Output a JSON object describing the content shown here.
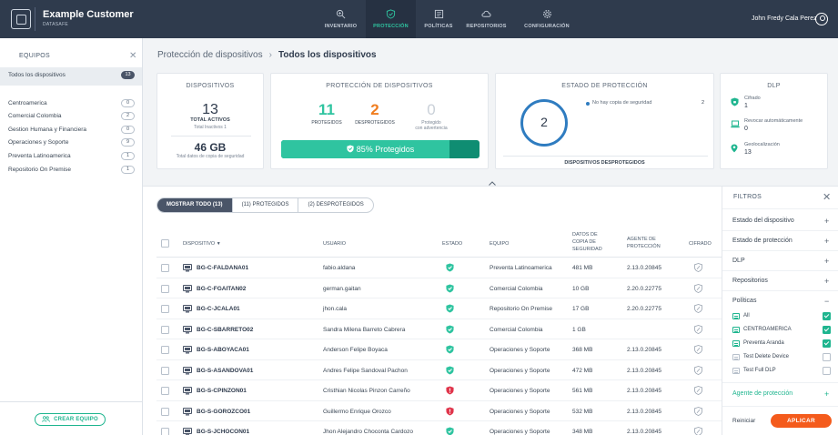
{
  "header": {
    "brand_title": "Example Customer",
    "brand_subtitle": "DATASAFE",
    "nav": [
      {
        "label": "INVENTARIO",
        "icon": "search-icon"
      },
      {
        "label": "PROTECCIÓN",
        "icon": "shield-icon",
        "active": true
      },
      {
        "label": "POLÍTICAS",
        "icon": "document-icon"
      },
      {
        "label": "REPOSITORIOS",
        "icon": "cloud-icon"
      },
      {
        "label": "CONFIGURACIÓN",
        "icon": "gear-icon"
      }
    ],
    "user_name": "John Fredy Cala Perez"
  },
  "sidebar": {
    "title": "EQUIPOS",
    "items": [
      {
        "label": "Todos los dispositivos",
        "count": "13"
      },
      {
        "label": "Centroamerica",
        "count": "0"
      },
      {
        "label": "Comercial Colombia",
        "count": "2"
      },
      {
        "label": "Gestion Humana y Financiera",
        "count": "0"
      },
      {
        "label": "Operaciones y Soporte",
        "count": "9"
      },
      {
        "label": "Preventa Latinoamerica",
        "count": "1"
      },
      {
        "label": "Repositorio On Premise",
        "count": "1"
      }
    ],
    "create_button": "CREAR EQUIPO"
  },
  "breadcrumb": {
    "parent": "Protección de dispositivos",
    "current": "Todos los dispositivos"
  },
  "cards": {
    "devices": {
      "title": "DISPOSITIVOS",
      "total": "13",
      "total_label": "TOTAL ACTIVOS",
      "inactive_label": "Total Inactivos 1",
      "backup_size": "46 GB",
      "backup_label": "Total datos de copia de seguridad"
    },
    "protection": {
      "title": "PROTECCIÓN DE DISPOSITIVOS",
      "protected": "11",
      "protected_label": "PROTEGIDOS",
      "unprotected": "2",
      "unprotected_label": "DESPROTEGIDOS",
      "warning": "0",
      "warning_label_1": "Protegido",
      "warning_label_2": "con advertencia",
      "progress_percent": 85,
      "progress_label": "85% Protegidos"
    },
    "status": {
      "title": "ESTADO DE PROTECCIÓN",
      "donut_value": "2",
      "legend_label": "No hay copia de seguridad",
      "legend_value": "2",
      "footer": "DISPOSITIVOS DESPROTEGIDOS"
    },
    "dlp": {
      "title": "DLP",
      "items": [
        {
          "label": "Cifrado",
          "value": "1"
        },
        {
          "label": "Revocar automáticamente",
          "value": "0"
        },
        {
          "label": "Geolocalización",
          "value": "13"
        }
      ]
    }
  },
  "tabs": [
    "MOSTRAR TODO (13)",
    "(11) PROTEGIDOS",
    "(2) DESPROTEGIDOS"
  ],
  "table": {
    "headers": {
      "device": "DISPOSITIVO",
      "user": "USUARIO",
      "status": "ESTADO",
      "team": "EQUIPO",
      "backup_1": "DATOS DE",
      "backup_2": "COPIA DE",
      "backup_3": "SEGURIDAD",
      "agent_1": "AGENTE DE",
      "agent_2": "PROTECCIÓN",
      "encrypt": "CIFRADO"
    },
    "rows": [
      {
        "device": "BG-C-FALDANA01",
        "user": "fabio.aldana",
        "status": "protected",
        "team": "Preventa Latinoamerica",
        "backup": "481 MB",
        "agent": "2.13.0.20845"
      },
      {
        "device": "BG-C-FGAITAN02",
        "user": "german.gaitan",
        "status": "protected",
        "team": "Comercial Colombia",
        "backup": "10 GB",
        "agent": "2.20.0.22775"
      },
      {
        "device": "BG-C-JCALA01",
        "user": "jhon.cala",
        "status": "protected",
        "team": "Repositorio On Premise",
        "backup": "17 GB",
        "agent": "2.20.0.22775"
      },
      {
        "device": "BG-C-SBARRETO02",
        "user": "Sandra Milena Barreto Cabrera",
        "status": "protected",
        "team": "Comercial Colombia",
        "backup": "1 GB",
        "agent": ""
      },
      {
        "device": "BG-S-ABOYACA01",
        "user": "Anderson Felipe Boyaca",
        "status": "protected",
        "team": "Operaciones y Soporte",
        "backup": "368 MB",
        "agent": "2.13.0.20845"
      },
      {
        "device": "BG-S-ASANDOVA01",
        "user": "Andres Felipe Sandoval Pachon",
        "status": "protected",
        "team": "Operaciones y Soporte",
        "backup": "472 MB",
        "agent": "2.13.0.20845"
      },
      {
        "device": "BG-S-CPINZON01",
        "user": "Cristhian Nicolas Pinzon Carreño",
        "status": "unprotected",
        "team": "Operaciones y Soporte",
        "backup": "561 MB",
        "agent": "2.13.0.20845"
      },
      {
        "device": "BG-S-GOROZCO01",
        "user": "Guillermo Enrique Orozco",
        "status": "unprotected",
        "team": "Operaciones y Soporte",
        "backup": "532 MB",
        "agent": "2.13.0.20845"
      },
      {
        "device": "BG-S-JCHOCON01",
        "user": "Jhon Alejandro Choconta Cardozo",
        "status": "protected",
        "team": "Operaciones y Soporte",
        "backup": "348 MB",
        "agent": "2.13.0.20845"
      }
    ]
  },
  "filters": {
    "title": "FILTROS",
    "sections": [
      {
        "label": "Estado del dispositivo",
        "toggle": "+"
      },
      {
        "label": "Estado de protección",
        "toggle": "+"
      },
      {
        "label": "DLP",
        "toggle": "+"
      },
      {
        "label": "Repositorios",
        "toggle": "+"
      },
      {
        "label": "Políticas",
        "toggle": "−"
      }
    ],
    "policies": [
      {
        "label": "All",
        "checked": true
      },
      {
        "label": "CENTROAMERICA",
        "checked": true
      },
      {
        "label": "Preventa Aranda",
        "checked": true
      },
      {
        "label": "Test Delete Device",
        "checked": false
      },
      {
        "label": "Test Full DLP",
        "checked": false
      }
    ],
    "agent_section": {
      "label": "Agente de protección",
      "toggle": "+"
    },
    "reset": "Reiniciar",
    "apply": "APLICAR"
  },
  "colors": {
    "topbar": "#2f3b4d",
    "accent": "#2fc4a0",
    "danger": "#e0354b",
    "warning": "#f07d1f",
    "apply": "#f45b1c",
    "donut": "#2f7cc0"
  }
}
